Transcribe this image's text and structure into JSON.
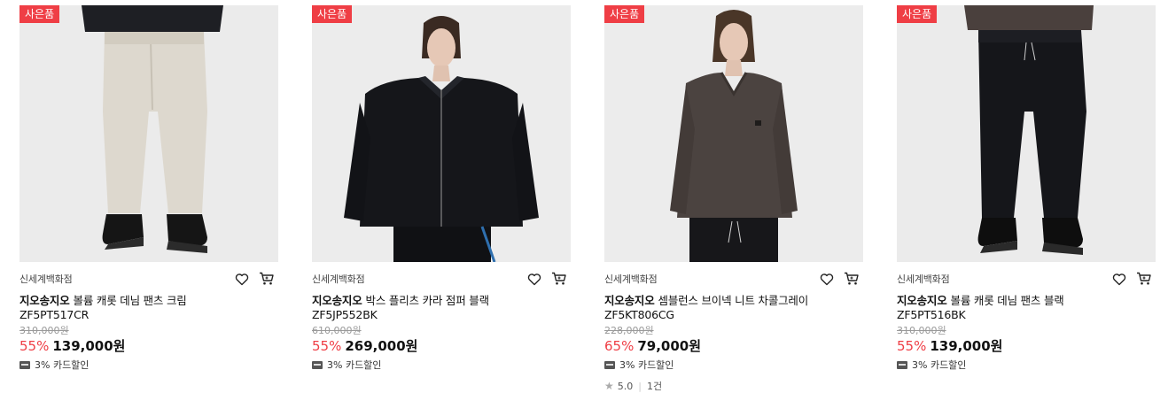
{
  "gift_badge": "사은품",
  "card_icon": "card-icon",
  "colors": {
    "accent": "#ef3e45",
    "image_bg": "#ebebeb"
  },
  "products": [
    {
      "seller": "신세계백화점",
      "brand": "지오송지오",
      "name": "볼륨 캐롯 데님 팬츠 크림 ZF5PT517CR",
      "original_price": "310,000원",
      "discount": "55%",
      "price": "139,000원",
      "card_discount": "3% 카드할인"
    },
    {
      "seller": "신세계백화점",
      "brand": "지오송지오",
      "name": "박스 플리츠 카라 점퍼 블랙 ZF5JP552BK",
      "original_price": "610,000원",
      "discount": "55%",
      "price": "269,000원",
      "card_discount": "3% 카드할인"
    },
    {
      "seller": "신세계백화점",
      "brand": "지오송지오",
      "name": "셈블런스 브이넥 니트 차콜그레이 ZF5KT806CG",
      "original_price": "228,000원",
      "discount": "65%",
      "price": "79,000원",
      "card_discount": "3% 카드할인",
      "rating": "5.0",
      "review_count": "1건"
    },
    {
      "seller": "신세계백화점",
      "brand": "지오송지오",
      "name": "볼륨 캐롯 데님 팬츠 블랙 ZF5PT516BK",
      "original_price": "310,000원",
      "discount": "55%",
      "price": "139,000원",
      "card_discount": "3% 카드할인"
    }
  ]
}
